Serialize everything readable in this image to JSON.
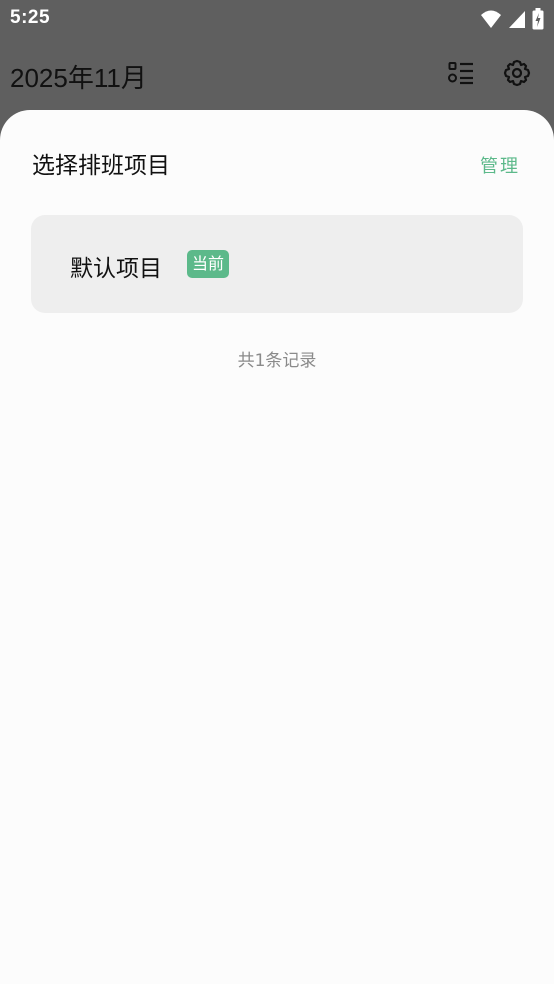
{
  "status_bar": {
    "time": "5:25"
  },
  "app_bar": {
    "title": "2025年11月",
    "icons": [
      "list-icon",
      "gear-icon"
    ]
  },
  "sheet": {
    "title": "选择排班项目",
    "manage_label": "管理",
    "projects": [
      {
        "name": "默认项目",
        "badge": "当前"
      }
    ],
    "count_text": "共1条记录"
  },
  "colors": {
    "accent": "#5cb98a",
    "scrim": "#5f5f5f",
    "sheet_bg": "#fcfcfc",
    "card_bg": "#eeeeee"
  }
}
